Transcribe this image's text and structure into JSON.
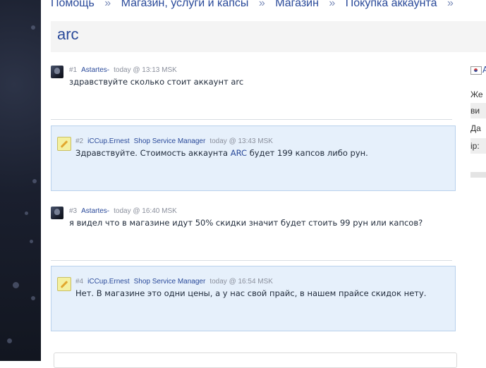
{
  "breadcrumb": {
    "items": [
      {
        "label": "Помощь"
      },
      {
        "label": "Магазин, услуги и капсы"
      },
      {
        "label": "Магазин"
      },
      {
        "label": "Покупка аккаунта"
      }
    ],
    "separator": "»"
  },
  "topic": {
    "title": "arc"
  },
  "posts": [
    {
      "num": "#1",
      "author": "Astartes-",
      "role": "",
      "time": "today @ 13:13 MSK",
      "text": "здравствуйте сколько стоит аккаунт arc"
    },
    {
      "num": "#2",
      "author": "iCCup.Ernest",
      "role": "Shop Service Manager",
      "time": "today @ 13:43 MSK",
      "text_before": "Здравствуйте. Стоимость аккаунта ",
      "text_highlight": "ARC",
      "text_after": " будет 199 капсов либо рун."
    },
    {
      "num": "#3",
      "author": "Astartes-",
      "role": "",
      "time": "today @ 16:40 MSK",
      "text": "я видел что в магазине идут 50% скидки значит будет стоить 99 рун или капсов?"
    },
    {
      "num": "#4",
      "author": "iCCup.Ernest",
      "role": "Shop Service Manager",
      "time": "today @ 16:54 MSK",
      "text": "Нет. В магазине это одни цены, а у нас свой прайс, в нашем прайсе скидок нету."
    }
  ],
  "sidebar": {
    "link": "A",
    "rows": [
      "Же",
      "ви",
      "Да",
      "ip:"
    ]
  },
  "colors": {
    "link": "#2a4a9a",
    "staff_bg": "#e6f0fb",
    "staff_border": "#b9d1ec"
  }
}
